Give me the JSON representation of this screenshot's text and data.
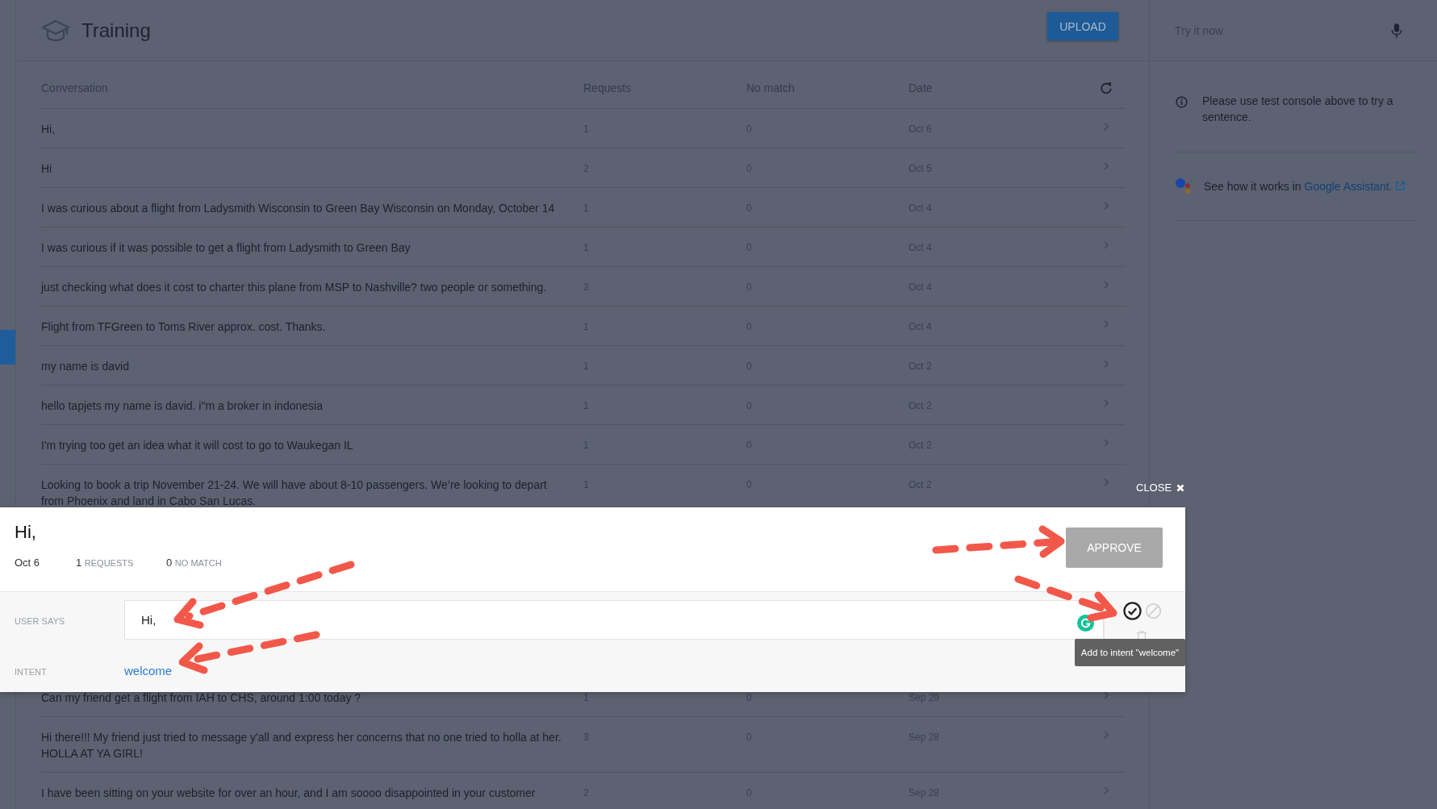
{
  "header": {
    "title": "Training",
    "upload_button": "UPLOAD"
  },
  "test_console": {
    "placeholder": "Try it now",
    "notice": "Please use test console above to try a sentence.",
    "assistant_text": "See how it works in",
    "assistant_link": "Google Assistant."
  },
  "table": {
    "columns": [
      "Conversation",
      "Requests",
      "No match",
      "Date"
    ],
    "rows_above": [
      {
        "text": "Hi,",
        "requests": "1",
        "no_match": "0",
        "date": "Oct 6"
      },
      {
        "text": "Hi",
        "requests": "2",
        "no_match": "0",
        "date": "Oct 5"
      },
      {
        "text": "I was curious about a flight from Ladysmith Wisconsin to Green Bay Wisconsin on Monday, October 14",
        "requests": "1",
        "no_match": "0",
        "date": "Oct 4"
      },
      {
        "text": "I was curious if it was possible to get a flight from Ladysmith to Green Bay",
        "requests": "1",
        "no_match": "0",
        "date": "Oct 4"
      },
      {
        "text": "just checking what does it cost to charter this plane from MSP to Nashville? two people or something.",
        "requests": "3",
        "no_match": "0",
        "date": "Oct 4"
      },
      {
        "text": "Flight from TFGreen to Toms River approx. cost. Thanks.",
        "requests": "1",
        "no_match": "0",
        "date": "Oct 4"
      },
      {
        "text": "my name is david",
        "requests": "1",
        "no_match": "0",
        "date": "Oct 2"
      },
      {
        "text": "hello tapjets my name is david. i\"m a broker in indonesia",
        "requests": "1",
        "no_match": "0",
        "date": "Oct 2"
      },
      {
        "text": "I'm trying too get an idea what it will cost to go to Waukegan IL",
        "requests": "1",
        "no_match": "0",
        "date": "Oct 2"
      },
      {
        "text": "Looking to book a trip November 21-24. We will have about 8-10 passengers. We’re looking to depart from Phoenix and land in Cabo San Lucas.",
        "requests": "1",
        "no_match": "0",
        "date": "Oct 2"
      }
    ],
    "rows_below": [
      {
        "text": "Can my friend get a flight from IAH to CHS, around 1:00 today ?",
        "requests": "1",
        "no_match": "0",
        "date": "Sep 29"
      },
      {
        "text": "Hi there!!! My friend just tried to message y'all and express her concerns that no one tried to holla at her. HOLLA AT YA GIRL!",
        "requests": "3",
        "no_match": "0",
        "date": "Sep 28"
      },
      {
        "text": "I have been sitting on your website for over an hour, and I am soooo disappointed in your customer",
        "requests": "2",
        "no_match": "0",
        "date": "Sep 28"
      }
    ]
  },
  "detail": {
    "close_button": "CLOSE",
    "title": "Hi,",
    "date": "Oct 6",
    "requests_count": "1",
    "requests_label": "REQUESTS",
    "no_match_count": "0",
    "no_match_label": "NO MATCH",
    "approve_button": "APPROVE",
    "approve_disabled": true,
    "user_says_label": "USER SAYS",
    "user_says_value": "Hi,",
    "intent_label": "INTENT",
    "intent_value": "welcome",
    "tooltip": "Add to intent \"welcome\""
  }
}
